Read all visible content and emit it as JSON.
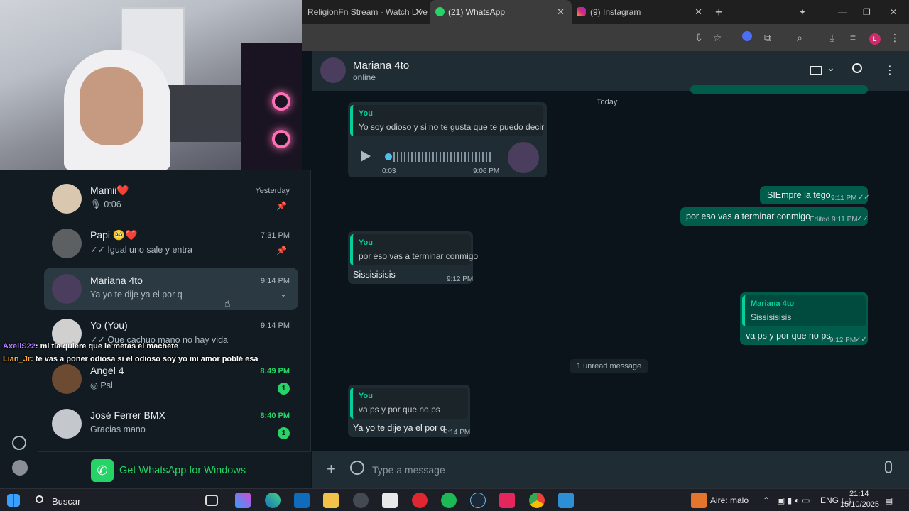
{
  "browser": {
    "tabs": [
      {
        "label": "ReligionFn Stream - Watch Live"
      },
      {
        "label": "(21) WhatsApp"
      },
      {
        "label": "(9) Instagram"
      }
    ]
  },
  "sidebar": {
    "chats": [
      {
        "name": "Mamii❤️",
        "preview": "🎙 0:06",
        "time": "Yesterday",
        "pinned": true
      },
      {
        "name": "Papi 🥺❤️",
        "preview": "✓✓ Igual uno sale y entra",
        "time": "7:31 PM",
        "pinned": true
      },
      {
        "name": "Mariana 4to",
        "preview": "Ya yo te dije ya el por q",
        "time": "9:14 PM"
      },
      {
        "name": "Yo (You)",
        "preview": "✓✓ Que cachuo mano no hay vida",
        "time": "9:14 PM"
      },
      {
        "name": "Angel 4",
        "preview": "◎ Psl",
        "time": "8:49 PM",
        "unread": "1"
      },
      {
        "name": "José Ferrer BMX",
        "preview": "Gracias mano",
        "time": "8:40 PM",
        "unread": "1"
      }
    ],
    "promo": "Get WhatsApp for Windows"
  },
  "stream_chat": [
    {
      "user": "AxellS22",
      "text": ": mi tia quiere que le metas el machete"
    },
    {
      "user": "Lian_Jr",
      "text": ": te vas a poner odiosa si el odioso soy yo mi amor poblé esa"
    }
  ],
  "chat": {
    "contact": "Mariana 4to",
    "status": "online",
    "date_chip": "Today",
    "messages": {
      "m1_quote_name": "You",
      "m1_quote_text": "Yo soy odioso y si no te gusta que te puedo decir",
      "m1_voice_duration": "0:03",
      "m1_time": "9:06 PM",
      "m2_text": "SIEmpre la tego",
      "m2_time": "9:11 PM",
      "m3_text": "por eso vas a terminar conmigo",
      "m3_time": "Edited 9:11 PM",
      "m4_quote_name": "You",
      "m4_quote_text": "por eso vas a terminar conmigo",
      "m4_text": "Sissisisisis",
      "m4_time": "9:12 PM",
      "m5_quote_name": "Mariana 4to",
      "m5_quote_text": "Sissisisisis",
      "m5_text": "va ps y por que no ps",
      "m5_time": "9:12 PM",
      "unread_chip": "1 unread message",
      "m6_quote_name": "You",
      "m6_quote_text": "va ps y por que no ps",
      "m6_text": "Ya yo te dije ya el por q",
      "m6_time": "9:14 PM"
    }
  },
  "composer": {
    "placeholder": "Type a message"
  },
  "taskbar": {
    "search": "Buscar",
    "weather": "Aire: malo",
    "lang": "ENG",
    "time": "21:14",
    "date": "15/10/2025"
  },
  "colors": {
    "accent": "#25d366",
    "outgoing": "#005c4b",
    "incoming": "#202c33",
    "quote_bar": "#06cf9c"
  }
}
